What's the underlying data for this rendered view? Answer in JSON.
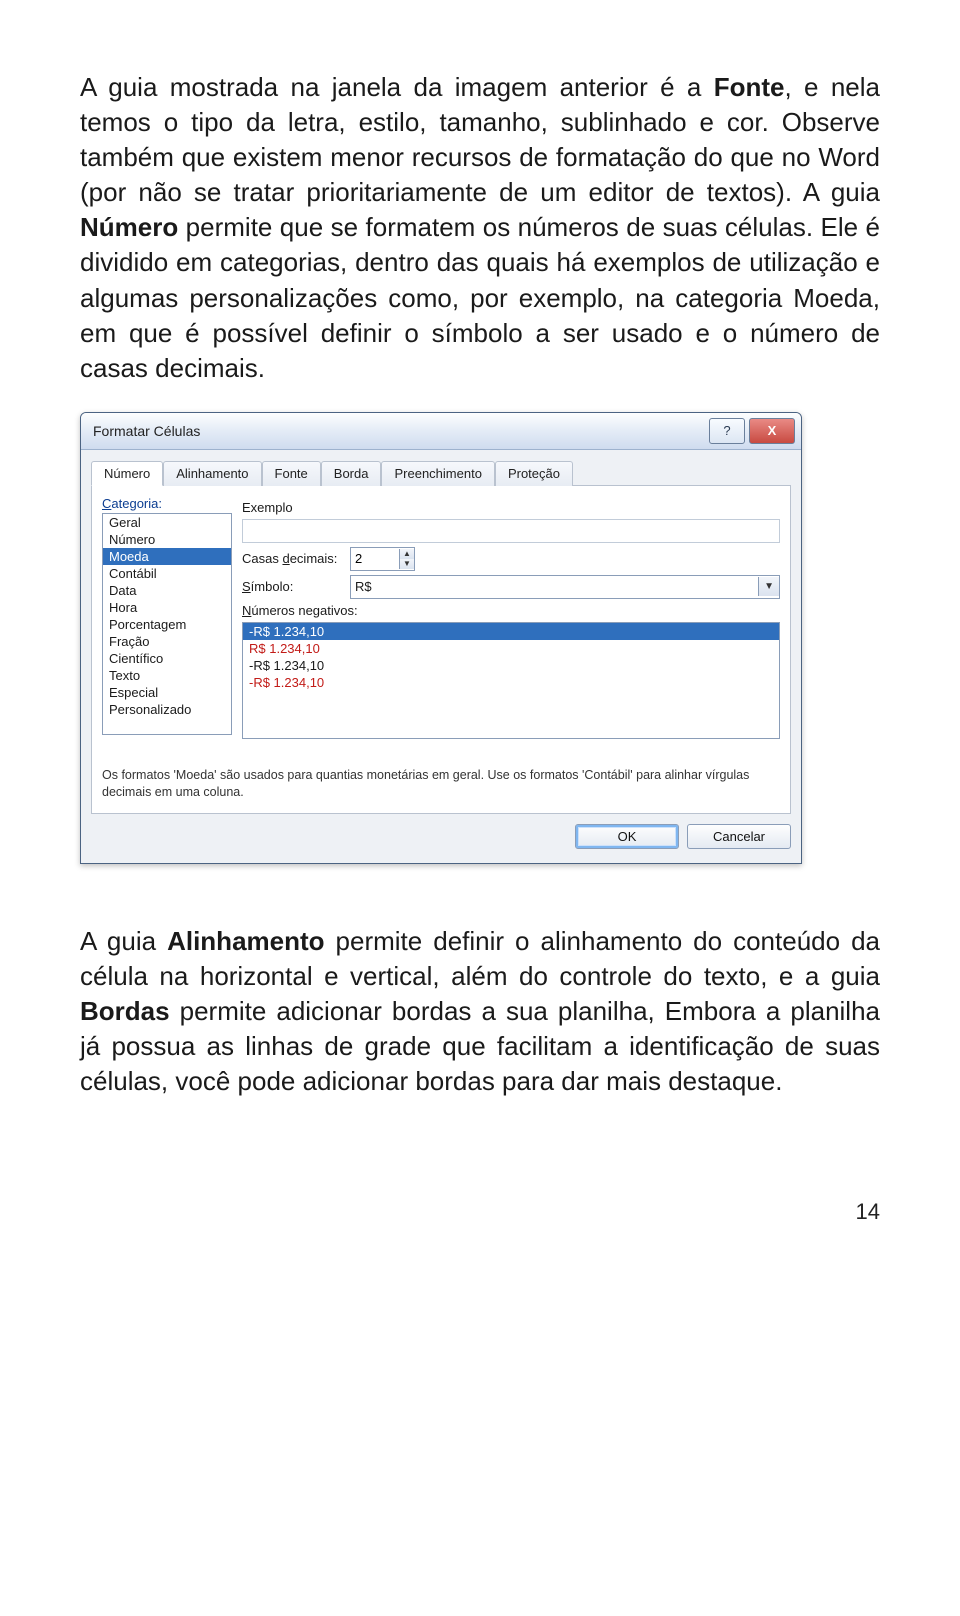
{
  "para1": {
    "t0": "A guia mostrada na janela da imagem anterior é a ",
    "fonte": "Fonte",
    "t1": ", e nela temos o tipo da letra, estilo, tamanho, sublinhado e cor. Observe também que existem menor recursos de formatação do que no Word (por não se tratar prioritariamente de um editor de textos). A guia ",
    "numero": "Número",
    "t2": " permite que se formatem os números de suas células. Ele é dividido em categorias, dentro das quais há exemplos de utilização e algumas personalizações como, por exemplo, na categoria Moeda, em que é possível definir o símbolo a ser usado e o número de casas decimais."
  },
  "dialog": {
    "title": "Formatar Células",
    "help": "?",
    "close": "X",
    "tabs": [
      "Número",
      "Alinhamento",
      "Fonte",
      "Borda",
      "Preenchimento",
      "Proteção"
    ],
    "active_tab": "Número",
    "categoria_label": "Categoria:",
    "categories": [
      "Geral",
      "Número",
      "Moeda",
      "Contábil",
      "Data",
      "Hora",
      "Porcentagem",
      "Fração",
      "Científico",
      "Texto",
      "Especial",
      "Personalizado"
    ],
    "selected_category": "Moeda",
    "exemplo_label": "Exemplo",
    "casas_label": "Casas decimais:",
    "casas_value": "2",
    "simbolo_label": "Símbolo:",
    "simbolo_value": "R$",
    "negativos_label": "Números negativos:",
    "negativos": [
      {
        "text": "-R$ 1.234,10",
        "red": true,
        "sel": true
      },
      {
        "text": "R$ 1.234,10",
        "red": true,
        "sel": false
      },
      {
        "text": "-R$ 1.234,10",
        "red": false,
        "sel": false
      },
      {
        "text": "-R$ 1.234,10",
        "red": true,
        "sel": false
      }
    ],
    "hint": "Os formatos 'Moeda' são usados para quantias monetárias em geral. Use os formatos 'Contábil' para alinhar vírgulas decimais em uma coluna.",
    "ok": "OK",
    "cancel": "Cancelar"
  },
  "para2": {
    "t0": "A guia ",
    "alinhamento": "Alinhamento",
    "t1": " permite definir o alinhamento do conteúdo da célula na horizontal e vertical, além do controle do texto, e a guia ",
    "bordas": "Bordas",
    "t2": " permite adicionar bordas a  sua planilha, Embora a planilha já possua as linhas de grade que facilitam a identificação de suas células, você pode adicionar bordas para dar mais destaque."
  },
  "pagenum": "14"
}
